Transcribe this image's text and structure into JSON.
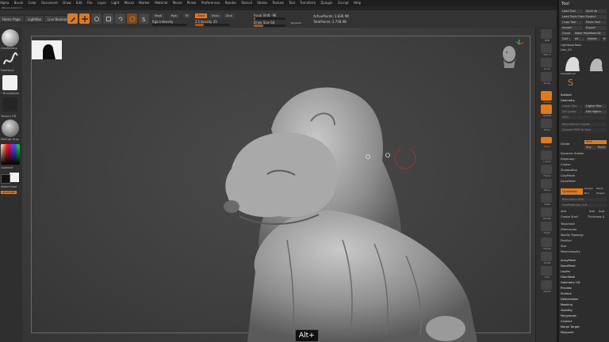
{
  "menu": {
    "items": [
      "Alpha",
      "Brush",
      "Color",
      "Document",
      "Draw",
      "Edit",
      "File",
      "Layer",
      "Light",
      "Macro",
      "Marker",
      "Material",
      "Movie",
      "Picker",
      "Preferences",
      "Render",
      "Stencil",
      "Stroke",
      "Texture",
      "Tool",
      "Transform",
      "Zplugin",
      "Zscript",
      "Help"
    ],
    "right": "Menus  DefaultZScript"
  },
  "subbar_text": "ZBrush 2022.0.5 ...",
  "toolbar": {
    "home_tab": "Home Page",
    "lightbox_tab": "LightBox",
    "livebool_tab": "Live Boolean",
    "mrgb": "Mrgb",
    "rgb": "Rgb",
    "m": "M",
    "zadd": "Zadd",
    "zsub": "Zsub",
    "zcut": "Zcut",
    "rgb_intensity": "Rgb Intensity",
    "z_intensity": "Z Intensity 25",
    "focal_shift": "Focal Shift -96",
    "draw_size": "Draw Size 64",
    "dynamic": "Dynamic",
    "active_points": "ActivePoints: 2.836 Mil",
    "total_points": "TotalPoints: 2.758 Mil",
    "z_intensity_level": 0.25,
    "focal_level": 0.05,
    "draw_size_level": 0.3
  },
  "left_shelf": {
    "brush_label": "ClayBuildup",
    "stroke_label": "FreeHand",
    "alpha_label": "~BrushAlpha",
    "texture_label": "Texture Off",
    "material_label": "MatCap Gray",
    "gradient_label": "Gradient",
    "switch_label": "SwitchColor",
    "alternate_label": "Alternate",
    "main_color": "#f2f2f2",
    "secondary_color": "#111111"
  },
  "right_shelf": {
    "buttons": [
      "BPR",
      "SPix 3",
      "Scroll",
      "Zoom",
      "Actual",
      "AAHalf",
      "Persp",
      "Floor",
      "L.Sym",
      "Frame",
      "Move",
      "Scale",
      "Rotate",
      "PolyF",
      "Transp",
      "Ghost",
      "Solo",
      "Xpose"
    ]
  },
  "tray": {
    "title": "Tool",
    "load_tool": "Load Tool",
    "save_as": "Save As",
    "load_tools_from_project": "Load Tools From Project",
    "copy_tool": "Copy Tool",
    "paste_tool": "Paste Tool",
    "import": "Import",
    "export": "Export",
    "clone": "Clone",
    "make_polymesh": "Make PolyMesh3D",
    "goz": "GoZ",
    "all": "All",
    "visible": "Visible",
    "r": "R",
    "lightbox_tools": "Lightbox▸Tools",
    "tool_name": "Lion_43",
    "r_value": "R",
    "thumb1_label": "Lion_43",
    "thumb2_label": "SimpleBrush",
    "sections": [
      "Subtool",
      "Geometry"
    ],
    "geometry_items": [
      "Lower Res",
      "Higher Res",
      "Del Lower",
      "Del Higher",
      "SDiv",
      "Reconstruct Subdiv",
      "Convert BPR To Geo",
      "Divide",
      "Smt",
      "Suv",
      "ReUV",
      "Dynamic Subdiv",
      "EdgeLoop",
      "Crease",
      "ShadowBox",
      "ClayPolish",
      "DynaMesh"
    ],
    "dynamesh_btn": "DynaMesh",
    "groups": "Groups",
    "polish": "Polish",
    "blur": "Blur",
    "project": "Project",
    "resolution": "Resolution 656",
    "subprojection": "SubProjection 0.6",
    "add": "Add",
    "sub": "Sub",
    "and": "And",
    "create_shell": "Create Shell",
    "thickness": "Thickness 4",
    "more_items": [
      "Tessimate",
      "ZRemesher",
      "Modify Topology",
      "Position",
      "Size",
      "MeshIntegrity"
    ],
    "bottom_items": [
      "ArrayMesh",
      "NanoMesh",
      "Layers",
      "FiberMesh",
      "Geometry HD",
      "Preview",
      "Surface",
      "Deformation",
      "Masking",
      "Visibility",
      "Polygroups",
      "Contact",
      "Morph Target",
      "Polypaint"
    ]
  },
  "canvas": {
    "alt_tooltip": "Alt+"
  }
}
